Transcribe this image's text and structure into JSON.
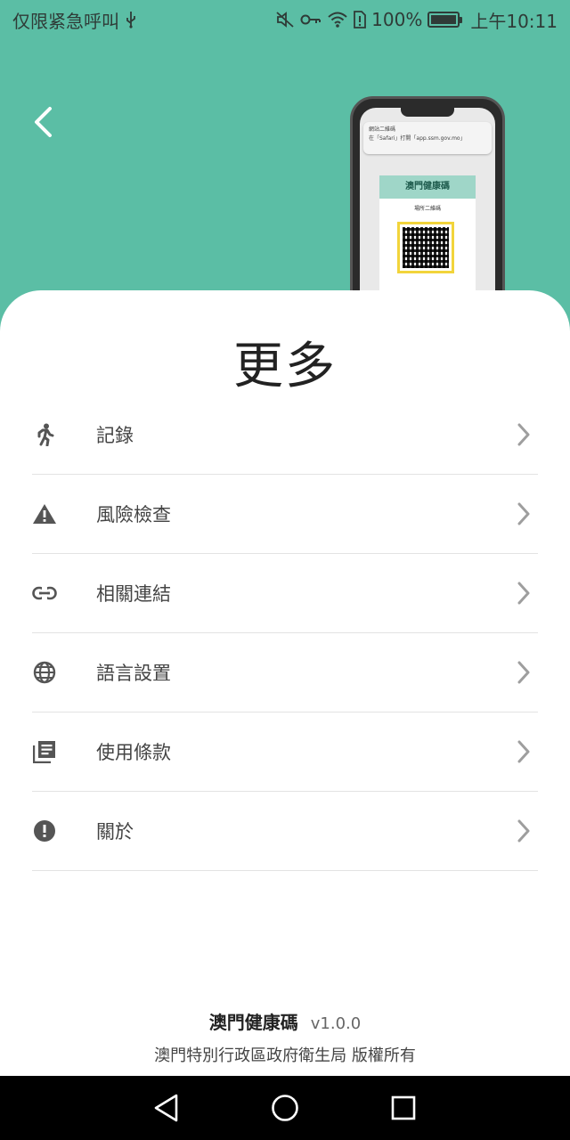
{
  "status_bar": {
    "left_text": "仅限紧急呼叫",
    "battery_text": "100%",
    "time": "上午10:11"
  },
  "header": {
    "back_icon": "chevron-left-icon"
  },
  "illustration": {
    "banner_line1": "網站二維碼",
    "banner_line2": "在「Safari」打開「app.ssm.gov.mo」",
    "card_title": "澳門健康碼",
    "card_subtitle": "場所二維碼"
  },
  "sheet": {
    "title": "更多",
    "items": [
      {
        "label": "記錄",
        "icon": "walking-person-icon"
      },
      {
        "label": "風險檢查",
        "icon": "warning-icon"
      },
      {
        "label": "相關連結",
        "icon": "link-icon"
      },
      {
        "label": "語言設置",
        "icon": "globe-icon"
      },
      {
        "label": "使用條款",
        "icon": "document-list-icon"
      },
      {
        "label": "關於",
        "icon": "info-exclamation-icon"
      }
    ]
  },
  "footer": {
    "app_name": "澳門健康碼",
    "version": "v1.0.0",
    "copyright": "澳門特別行政區政府衛生局 版權所有"
  },
  "colors": {
    "header_bg": "#5bbea5",
    "sheet_bg": "#ffffff",
    "nav_bg": "#000000"
  }
}
